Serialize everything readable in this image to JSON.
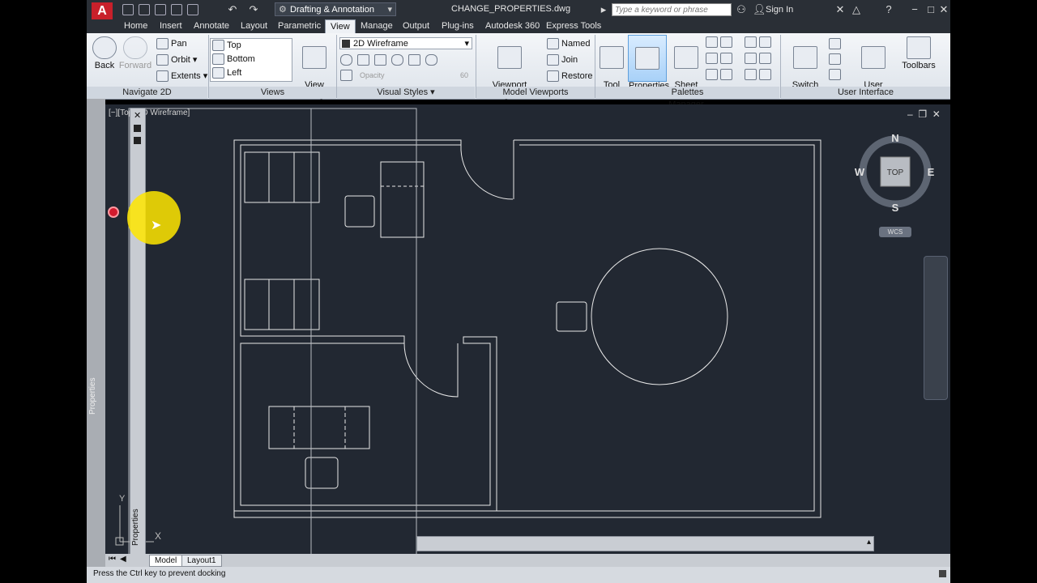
{
  "title_bar": {
    "logo": "A",
    "workspace": "Drafting & Annotation",
    "document": "CHANGE_PROPERTIES.dwg",
    "search_placeholder": "Type a keyword or phrase",
    "signin": "Sign In"
  },
  "tabs": [
    "Home",
    "Insert",
    "Annotate",
    "Layout",
    "Parametric",
    "View",
    "Manage",
    "Output",
    "Plug-ins",
    "Autodesk 360",
    "Express Tools"
  ],
  "active_tab": "View",
  "ribbon": {
    "navigate": {
      "back": "Back",
      "forward": "Forward",
      "pan": "Pan",
      "orbit": "Orbit",
      "extents": "Extents",
      "title": "Navigate 2D"
    },
    "views": {
      "items": [
        "Top",
        "Bottom",
        "Left"
      ],
      "manager": "View\nManager",
      "title": "Views"
    },
    "visual_styles": {
      "current": "2D Wireframe",
      "opacity_label": "Opacity",
      "opacity_value": "60",
      "title": "Visual Styles"
    },
    "model_viewports": {
      "config": "Viewport\nConfiguration",
      "named": "Named",
      "join": "Join",
      "restore": "Restore",
      "title": "Model Viewports"
    },
    "palettes": {
      "tool_palettes": "Tool\nPalettes",
      "properties": "Properties",
      "sheet_set": "Sheet Set\nManager",
      "title": "Palettes"
    },
    "user_interface": {
      "switch_windows": "Switch\nWindows",
      "user_interface": "User\nInterface",
      "toolbars": "Toolbars",
      "title": "User Interface"
    }
  },
  "viewport_label": "[−][Top][2D Wireframe]",
  "viewcube": {
    "n": "N",
    "s": "S",
    "e": "E",
    "w": "W",
    "face": "TOP",
    "wcs": "WCS"
  },
  "axis": {
    "y": "Y",
    "x": "X"
  },
  "palette_label": "Properties",
  "left_strip_label": "Properties",
  "layout_tabs": [
    "Model",
    "Layout1"
  ],
  "status_text": "Press the Ctrl key to prevent docking",
  "colors": {
    "canvas": "#222832",
    "lines": "#e8e8e8",
    "accent": "#c8202b"
  }
}
